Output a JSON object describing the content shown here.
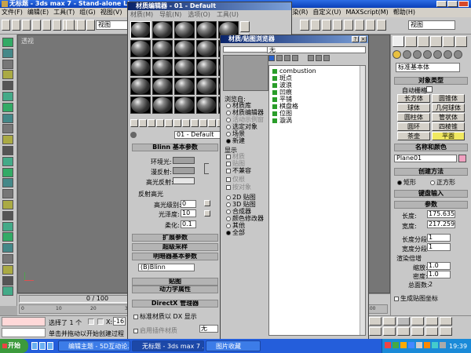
{
  "app": {
    "title": "无标题 - 3ds max 7 - Stand-alone License",
    "menu": [
      "文件(F)",
      "编辑(E)",
      "工具(T)",
      "组(G)",
      "视图(V)",
      "创建(C)",
      "修改器(O)",
      "reactor",
      "动画(A)",
      "图表编辑器(D)",
      "渲染(R)",
      "自定义(U)",
      "MAXScript(M)",
      "帮助(H)"
    ],
    "view_dropdown": "视图",
    "view_dropdown2": "视图",
    "viewport_label": "透视"
  },
  "mat_editor": {
    "title": "材质编辑器 - 01 - Default",
    "menu": [
      "材质(M)",
      "导航(N)",
      "选项(O)",
      "工具(U)"
    ],
    "material_name": "01 - Default",
    "shader_rollout": "Blinn 基本参数",
    "ambient": "环境光:",
    "diffuse": "漫反射:",
    "specular": "高光反射:",
    "spec_hi_title": "反射高光",
    "spec_level_label": "高光级别:",
    "spec_level": "0",
    "gloss_label": "光泽度:",
    "gloss": "10",
    "soften_label": "柔化:",
    "soften": "0.1",
    "rollouts": [
      "扩展参数",
      "超级采样",
      "明暗器基本参数",
      "贴图",
      "动力学属性",
      "DirectX 管理器"
    ],
    "shader_type": "(B)Blinn",
    "dx_display": "标准材质以 DX 显示",
    "enable_plugin": "启用插件材质",
    "plugin_value": "无"
  },
  "browser": {
    "title": "材质/贴图浏览器",
    "name_field": "无",
    "items": [
      "combustion",
      "斑点",
      "波浪",
      "凹痕",
      "平铺",
      "棋盘格",
      "位图",
      "漩涡"
    ],
    "browse_from_label": "浏览自:",
    "browse_from": [
      "材质库",
      "材质编辑器",
      "活动示例窗",
      "选定对象",
      "场景",
      "新建"
    ],
    "show_label": "显示",
    "show": [
      "材质",
      "贴图",
      "不兼容"
    ],
    "show2": [
      "仅根",
      "按对象"
    ],
    "types": [
      "2D 贴图",
      "3D 贴图",
      "合成器",
      "颜色修改器",
      "其他",
      "全部"
    ]
  },
  "command": {
    "category": "标准基本体",
    "object_type_hdr": "对象类型",
    "autogrid": "自动栅格",
    "objects": [
      "长方体",
      "圆锥体",
      "球体",
      "几何球体",
      "圆柱体",
      "管状体",
      "圆环",
      "四棱锥",
      "茶壶",
      "平面"
    ],
    "name_color_hdr": "名称和颜色",
    "object_name": "Plane01",
    "method_hdr": "创建方法",
    "method_rect": "矩形",
    "method_square": "正方形",
    "kb_entry": "键盘输入",
    "params_hdr": "参数",
    "length_label": "长度:",
    "length": "175.635",
    "width_label": "宽度:",
    "width": "217.259",
    "len_segs_label": "长度分段:",
    "len_segs": "1",
    "wid_segs_label": "宽度分段:",
    "wid_segs": "1",
    "render_mult": "渲染倍增",
    "scale_label": "缩放:",
    "scale": "1.0",
    "density_label": "密度:",
    "density": "1.0",
    "total_faces_label": "总面数:",
    "total_faces": "2",
    "gen_map": "生成贴图坐标"
  },
  "timeline": {
    "frame": "0 / 100",
    "ticks": [
      "0",
      "10",
      "20",
      "30",
      "40",
      "50",
      "60",
      "70",
      "80",
      "90",
      "100"
    ]
  },
  "status": {
    "selected": "选择了 1 个",
    "x_label": "X:",
    "x_value": "-16.",
    "prompt": "单击并拖动以开始创建过程"
  },
  "taskbar": {
    "start": "开始",
    "items": [
      "编辑主题 - 5D互动论...",
      "无标题 - 3ds max 7 ...",
      "图片收藏"
    ],
    "clock": "19:39"
  },
  "colors": {
    "taskbar": "#245edb",
    "start": "#3c9a3c",
    "selected_obj": "#f0e860",
    "swatch_ambient": "#a0a0a0",
    "swatch_specular": "#e6e6e6",
    "name_color": "#f0a0c0"
  }
}
